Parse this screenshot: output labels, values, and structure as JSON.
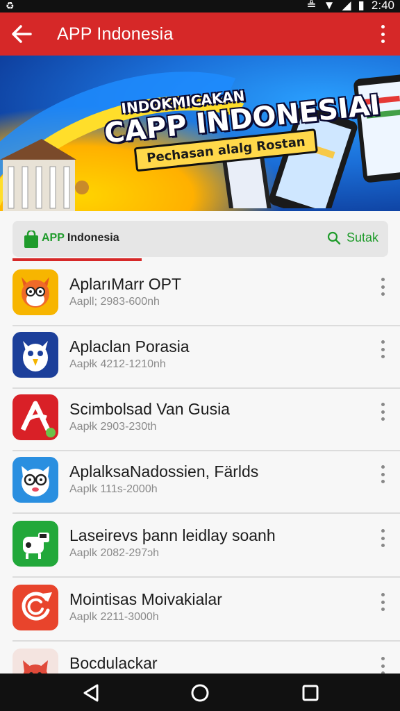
{
  "status": {
    "time": "2:40"
  },
  "appbar": {
    "title": "APP Indonesia"
  },
  "banner": {
    "line1": "INDOKMICAKAN",
    "line2": "CAPP INDONESIAI",
    "line3": "Pechasan alalg Rostan"
  },
  "search": {
    "brand_a": "APP",
    "brand_b": "Indonesia",
    "button_label": "Sutak"
  },
  "apps": [
    {
      "name": "AplarıMarr OPT",
      "meta": "Aapll;  2983-600nh",
      "icon": "fox-mascot-icon",
      "color": "#f7b500"
    },
    {
      "name": "Aplaclan Porasia",
      "meta": "Aapłk  4212-1210nh",
      "icon": "owl-mascot-icon",
      "color": "#1c3f9a"
    },
    {
      "name": "Scimbolsad Van Gusia",
      "meta": "Aapłk  2903-230th",
      "icon": "letter-a-logo-icon",
      "color": "#d92027"
    },
    {
      "name": "AplalksaNadossien, Färlds",
      "meta": "Aaplk  111s-2000h",
      "icon": "cat-glasses-icon",
      "color": "#2a8fe0"
    },
    {
      "name": "Laseirevs þann leidlay soanh",
      "meta": "Aaplk  2082-297ɔh",
      "icon": "cow-mascot-icon",
      "color": "#22a83a"
    },
    {
      "name": "Mointisas Moivakialar",
      "meta": "Aaplk  2211-3000h",
      "icon": "swirl-logo-icon",
      "color": "#e8442c"
    },
    {
      "name": "Bocdulackar",
      "meta": "",
      "icon": "red-cat-icon",
      "color": "#e04a3a"
    }
  ]
}
